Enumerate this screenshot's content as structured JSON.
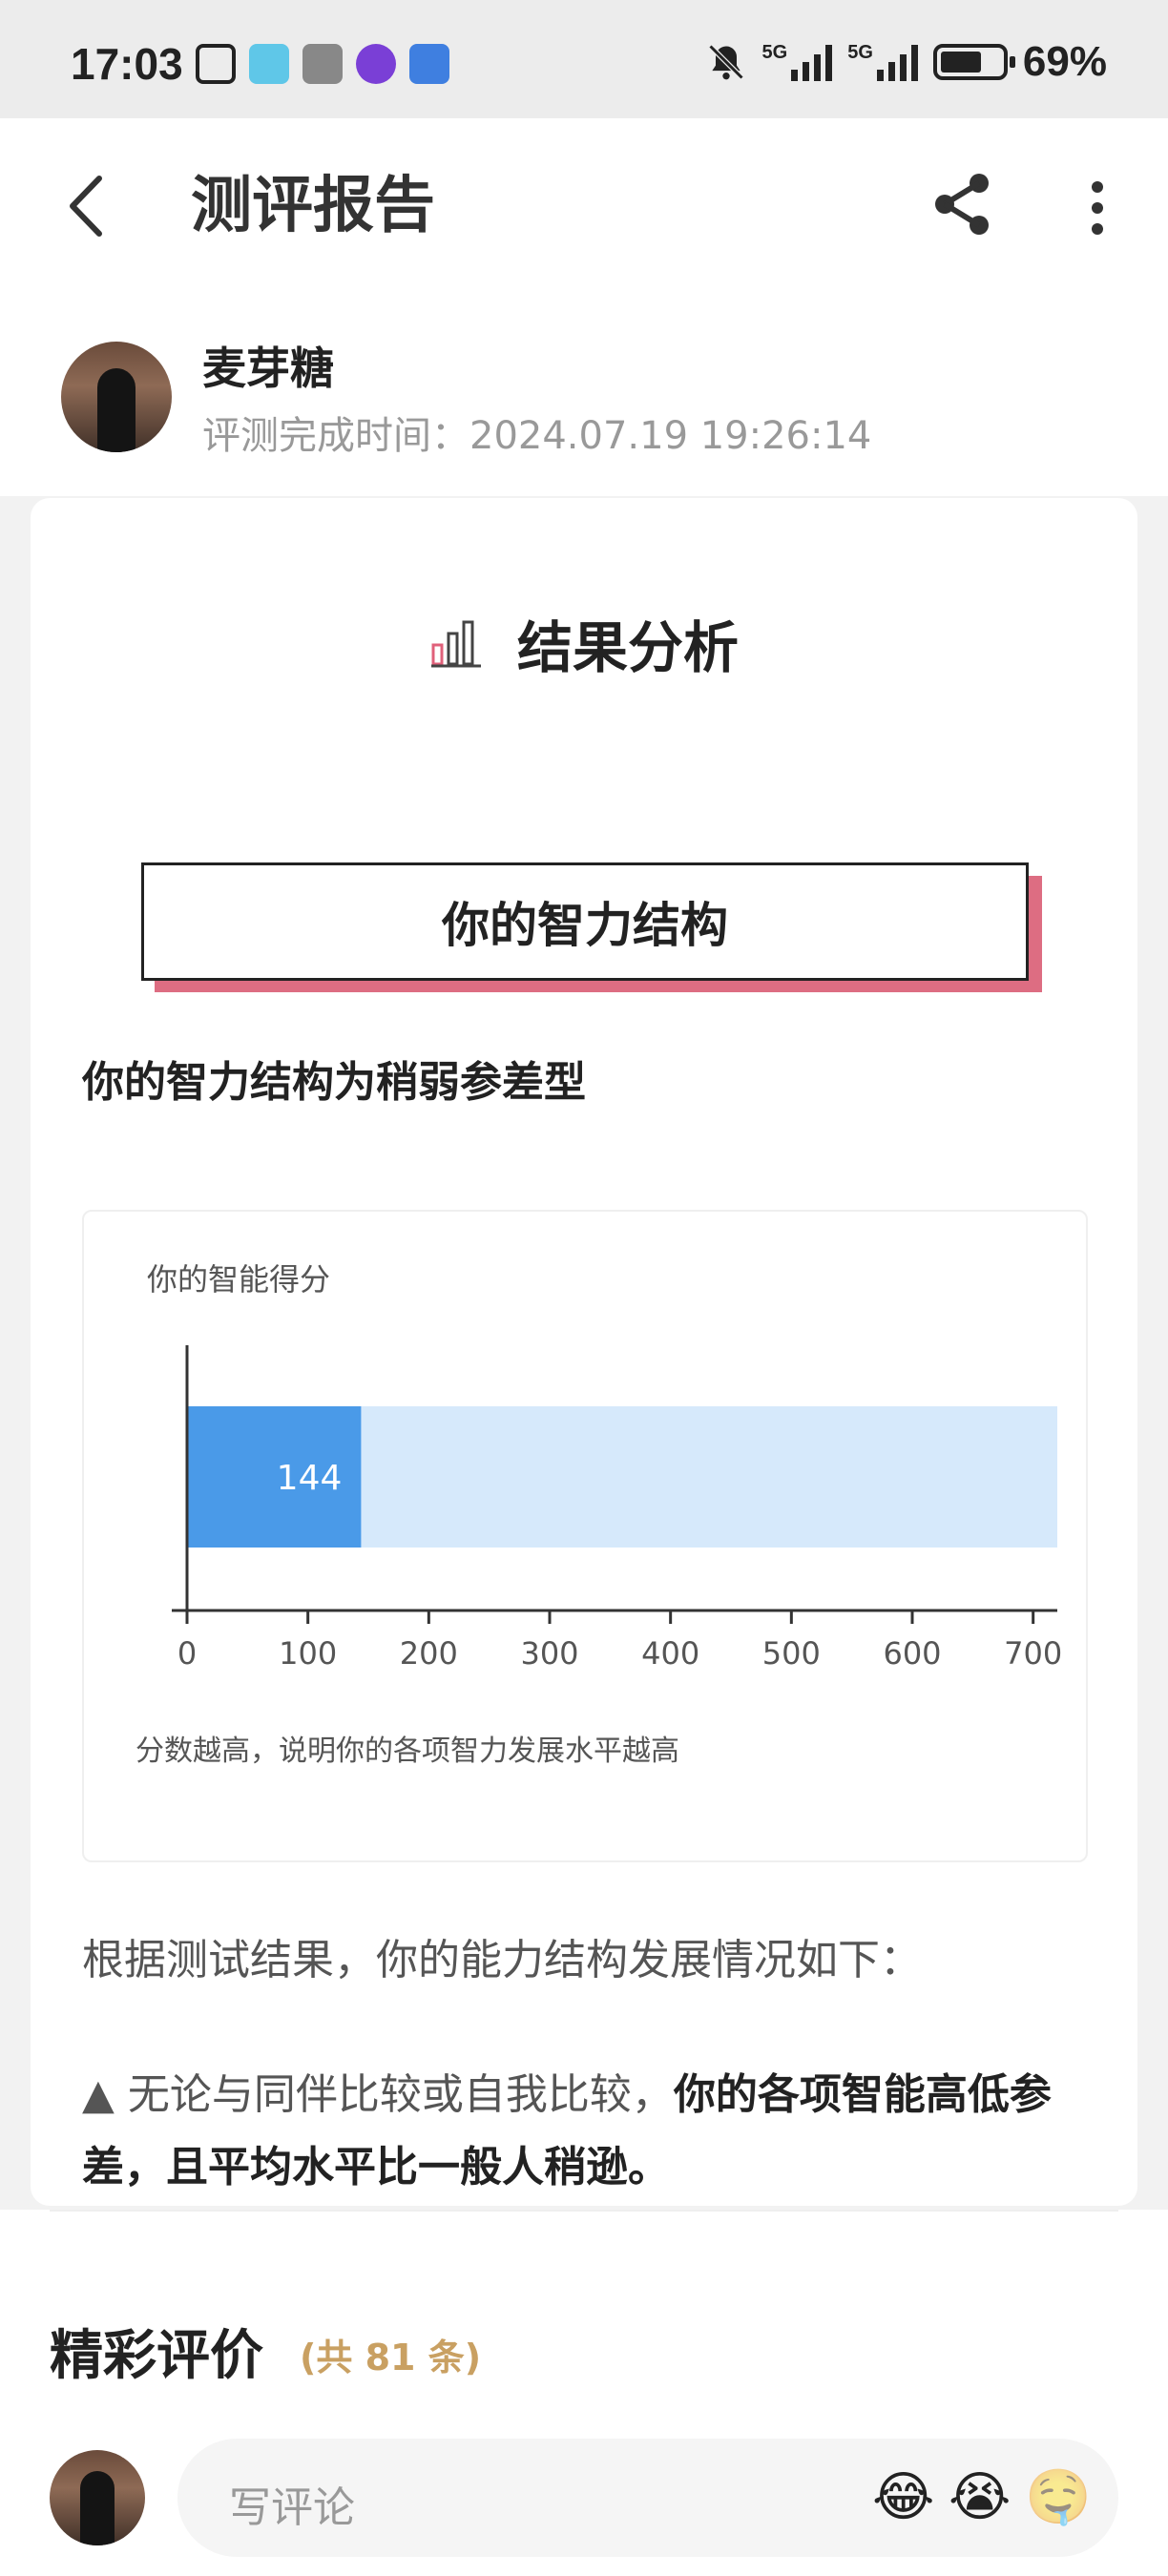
{
  "status_bar": {
    "time": "17:03",
    "battery": "69%",
    "network_1": "5G",
    "network_2": "5G"
  },
  "header": {
    "title": "测评报告"
  },
  "user": {
    "name": "麦芽糖",
    "complete_time": "评测完成时间：2024.07.19 19:26:14"
  },
  "result": {
    "title": "结果分析",
    "section_label": "你的智力结构",
    "structure_text": "你的智力结构为稍弱参差型",
    "intro": "根据测试结果，你的能力结构发展情况如下：",
    "bullet_plain": "▲ 无论与同伴比较或自我比较，",
    "bullet_bold": "你的各项智能高低参差，且平均水平比一般人稍逊。"
  },
  "chart_data": {
    "type": "bar",
    "orientation": "horizontal",
    "title": "你的智能得分",
    "categories": [
      ""
    ],
    "values": [
      144
    ],
    "value_labels": [
      "144"
    ],
    "xlim": [
      0,
      720
    ],
    "xticks": [
      0,
      100,
      200,
      300,
      400,
      500,
      600,
      700
    ],
    "note": "分数越高，说明你的各项智力发展水平越高",
    "bar_color": "#4a9ae8",
    "track_color": "#d6e9fb"
  },
  "comments": {
    "title": "精彩评价",
    "count": "(共 81 条)",
    "placeholder": "写评论",
    "emojis": [
      "😂",
      "😭",
      "🤤"
    ]
  },
  "colors": {
    "accent_pink": "#dd6d82",
    "count_gold": "#c9a062"
  }
}
